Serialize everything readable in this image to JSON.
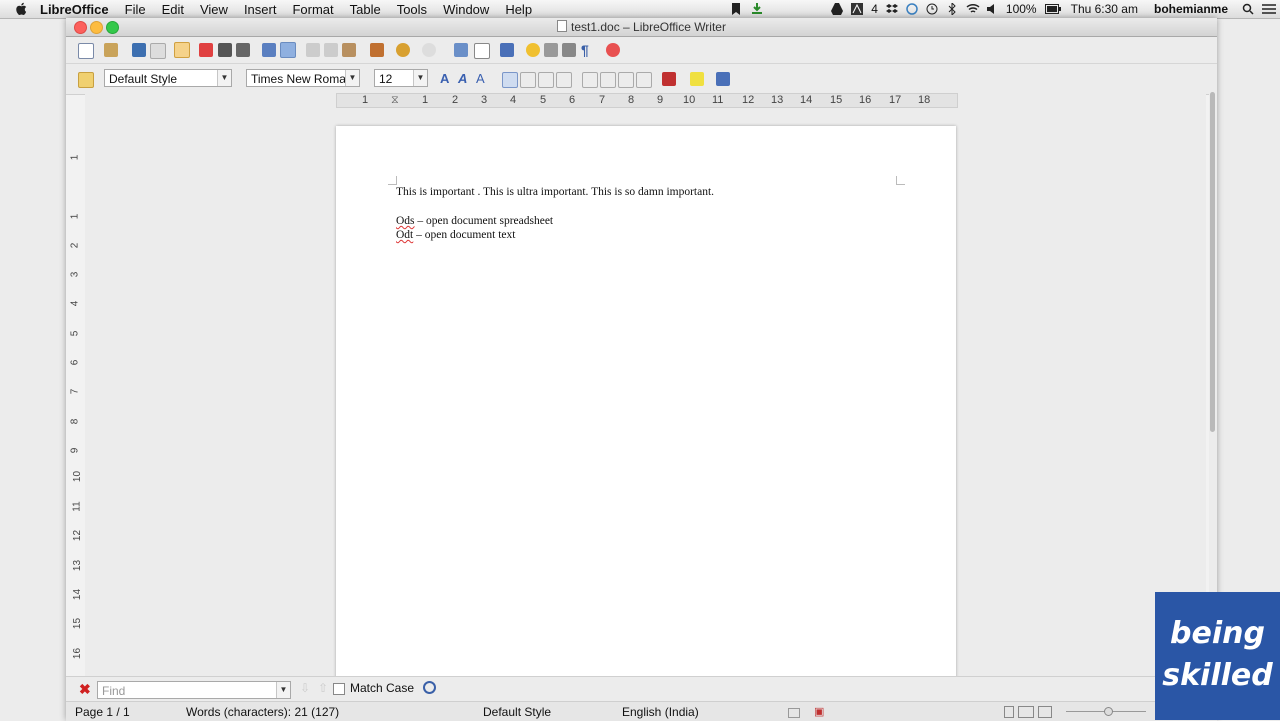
{
  "menubar": {
    "app": "LibreOffice",
    "items": [
      "File",
      "Edit",
      "View",
      "Insert",
      "Format",
      "Table",
      "Tools",
      "Window",
      "Help"
    ],
    "status": {
      "adobe_count": "4",
      "battery": "100%",
      "clock": "Thu 6:30 am",
      "user": "bohemianme"
    }
  },
  "window": {
    "title": "test1.doc – LibreOffice Writer"
  },
  "formatting": {
    "paragraph_style": "Default Style",
    "font_name": "Times New Roman",
    "font_size": "12"
  },
  "ruler": {
    "h_numbers": [
      "1",
      "1",
      "2",
      "3",
      "4",
      "5",
      "6",
      "7",
      "8",
      "9",
      "10",
      "11",
      "12",
      "13",
      "14",
      "15",
      "16",
      "17",
      "18"
    ],
    "v_numbers": [
      "1",
      "1",
      "2",
      "3",
      "4",
      "5",
      "6",
      "7",
      "8",
      "9",
      "10",
      "11",
      "12",
      "13",
      "14",
      "15",
      "16"
    ]
  },
  "document": {
    "line1": "This is important . This is ultra important. This is so damn important.",
    "line2_word": "Ods",
    "line2_rest": " – open document spreadsheet",
    "line3_word": "Odt",
    "line3_rest": " – open document text"
  },
  "findbar": {
    "placeholder": "Find",
    "match_case": "Match Case"
  },
  "statusbar": {
    "page": "Page 1 / 1",
    "words": "Words (characters): 21 (127)",
    "style": "Default Style",
    "language": "English (India)"
  },
  "badge": {
    "line1": "being",
    "line2": "skilled"
  },
  "colors": {
    "accent": "#2a56a6",
    "close": "#fc605c",
    "min": "#fdbc40",
    "max": "#34c84a"
  }
}
